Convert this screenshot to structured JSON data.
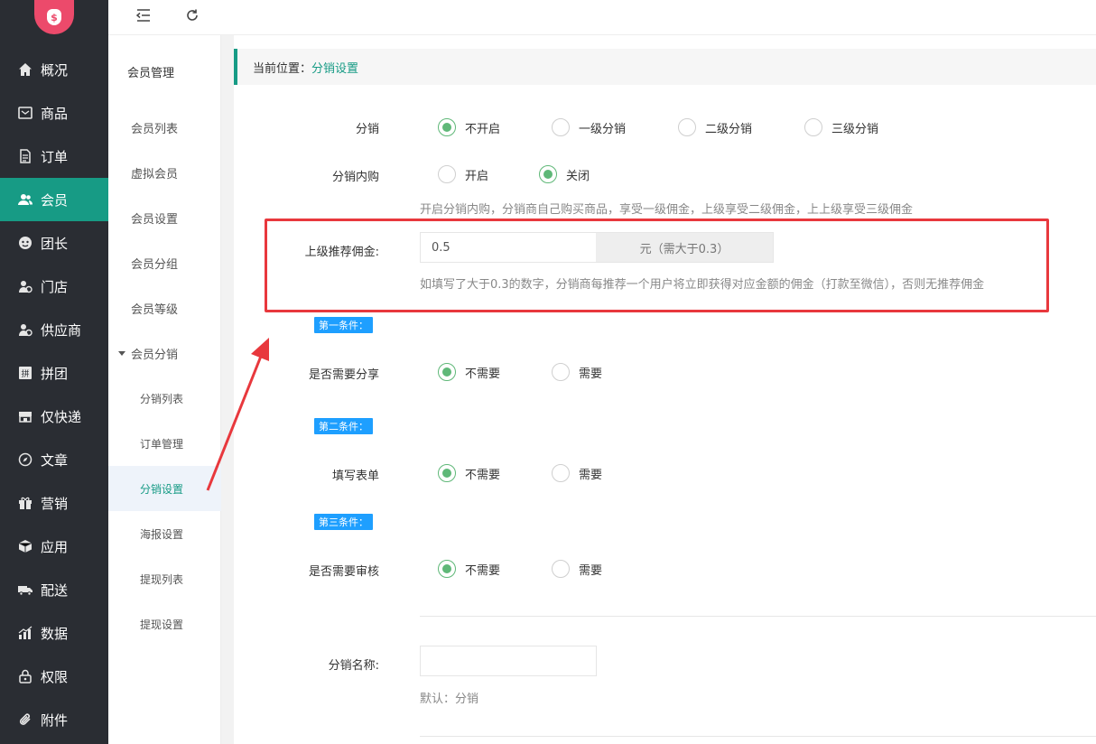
{
  "sidebar": {
    "items": [
      {
        "label": "概况",
        "icon": "home-icon"
      },
      {
        "label": "商品",
        "icon": "mail-icon"
      },
      {
        "label": "订单",
        "icon": "document-icon"
      },
      {
        "label": "会员",
        "icon": "users-icon"
      },
      {
        "label": "团长",
        "icon": "leader-icon"
      },
      {
        "label": "门店",
        "icon": "store-icon"
      },
      {
        "label": "供应商",
        "icon": "supplier-icon"
      },
      {
        "label": "拼团",
        "icon": "group-buy-icon"
      },
      {
        "label": "仅快递",
        "icon": "express-icon"
      },
      {
        "label": "文章",
        "icon": "compass-icon"
      },
      {
        "label": "营销",
        "icon": "gift-icon"
      },
      {
        "label": "应用",
        "icon": "box-icon"
      },
      {
        "label": "配送",
        "icon": "truck-icon"
      },
      {
        "label": "数据",
        "icon": "chart-icon"
      },
      {
        "label": "权限",
        "icon": "lock-icon"
      },
      {
        "label": "附件",
        "icon": "paperclip-icon"
      }
    ],
    "active_index": 3,
    "accent": "#179b85"
  },
  "subnav": {
    "title": "会员管理",
    "items": [
      "会员列表",
      "虚拟会员",
      "会员设置",
      "会员分组",
      "会员等级"
    ],
    "group": "会员分销",
    "children": [
      "分销列表",
      "订单管理",
      "分销设置",
      "海报设置",
      "提现列表",
      "提现设置"
    ],
    "active_child": 2
  },
  "breadcrumb": {
    "prefix": "当前位置：",
    "current": "分销设置"
  },
  "form": {
    "distribution": {
      "label": "分销",
      "options": [
        "不开启",
        "一级分销",
        "二级分销",
        "三级分销"
      ],
      "selected": 0
    },
    "self_purchase": {
      "label": "分销内购",
      "options": [
        "开启",
        "关闭"
      ],
      "selected": 1,
      "hint": "开启分销内购，分销商自己购买商品，享受一级佣金，上级享受二级佣金，上上级享受三级佣金"
    },
    "referral_commission": {
      "label": "上级推荐佣金:",
      "value": "0.5",
      "addon": "元（需大于0.3）",
      "hint": "如填写了大于0.3的数字，分销商每推荐一个用户将立即获得对应金额的佣金（打款至微信），否则无推荐佣金"
    },
    "condition1": {
      "tag": "第一条件：",
      "label": "是否需要分享",
      "options": [
        "不需要",
        "需要"
      ],
      "selected": 0
    },
    "condition2": {
      "tag": "第二条件：",
      "label": "填写表单",
      "options": [
        "不需要",
        "需要"
      ],
      "selected": 0
    },
    "condition3": {
      "tag": "第三条件：",
      "label": "是否需要审核",
      "options": [
        "不需要",
        "需要"
      ],
      "selected": 0
    },
    "name": {
      "label": "分销名称:",
      "value": "",
      "hint": "默认：分销"
    }
  },
  "colors": {
    "highlight": "#e8383d",
    "tag": "#1e9fff",
    "radio_on": "#5fb878"
  }
}
